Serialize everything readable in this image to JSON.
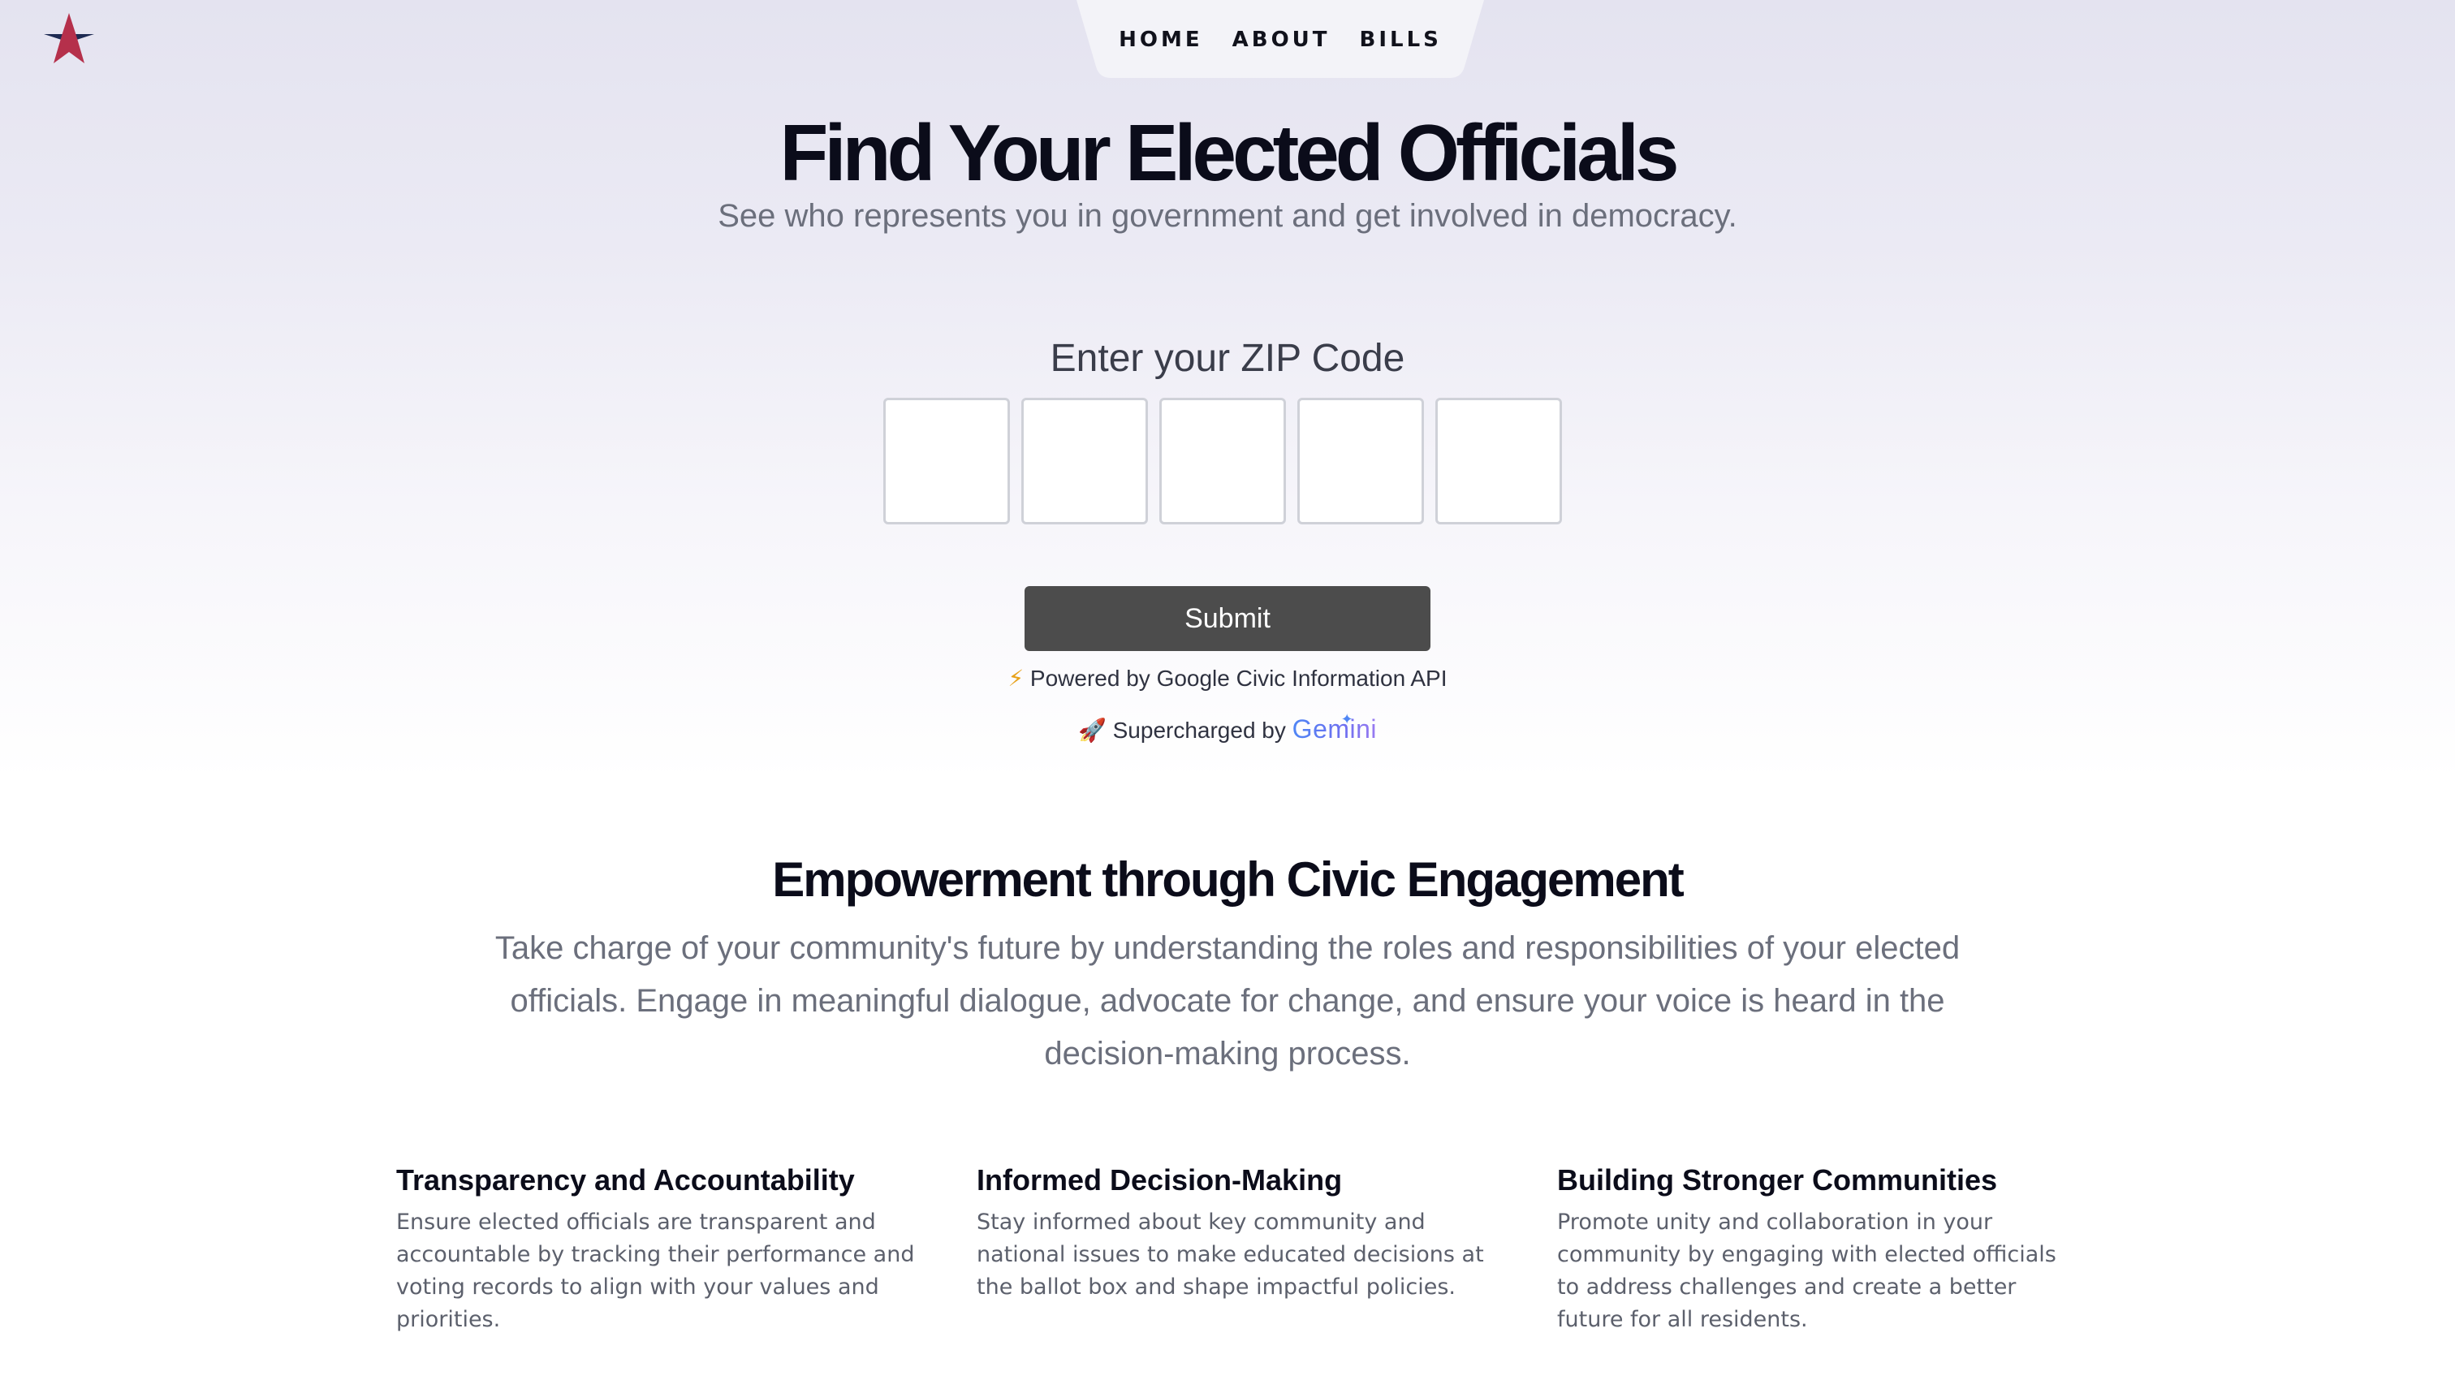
{
  "nav": {
    "links": [
      "HOME",
      "ABOUT",
      "BILLS"
    ],
    "logo_icon": "star-logo-icon"
  },
  "hero": {
    "title": "Find Your Elected Officials",
    "subtitle": "See who represents you in government and get involved in democracy."
  },
  "zip": {
    "label": "Enter your ZIP Code",
    "digits": [
      "",
      "",
      "",
      "",
      ""
    ],
    "submit_label": "Submit"
  },
  "credits": {
    "powered_icon": "⚡",
    "powered_text": "Powered by Google Civic Information API",
    "supercharged_icon": "🚀",
    "supercharged_text": "Supercharged by",
    "gemini_logo_text": "Gemini"
  },
  "section": {
    "title": "Empowerment through Civic Engagement",
    "body": "Take charge of your community's future by understanding the roles and responsibilities of your elected officials. Engage in meaningful dialogue, advocate for change, and ensure your voice is heard in the decision-making process."
  },
  "features": [
    {
      "title": "Transparency and Accountability",
      "text": "Ensure elected officials are transparent and accountable by tracking their performance and voting records to align with your values and priorities."
    },
    {
      "title": "Informed Decision-Making",
      "text": "Stay informed about key community and national issues to make educated decisions at the ballot box and shape impactful policies."
    },
    {
      "title": "Building Stronger Communities",
      "text": "Promote unity and collaboration in your community by engaging with elected officials to address challenges and create a better future for all residents."
    }
  ],
  "colors": {
    "star_red": "#b5304b",
    "star_navy": "#1d2a52",
    "submit_bg": "#4c4c4c",
    "nav_bg": "#f3f3f8"
  }
}
